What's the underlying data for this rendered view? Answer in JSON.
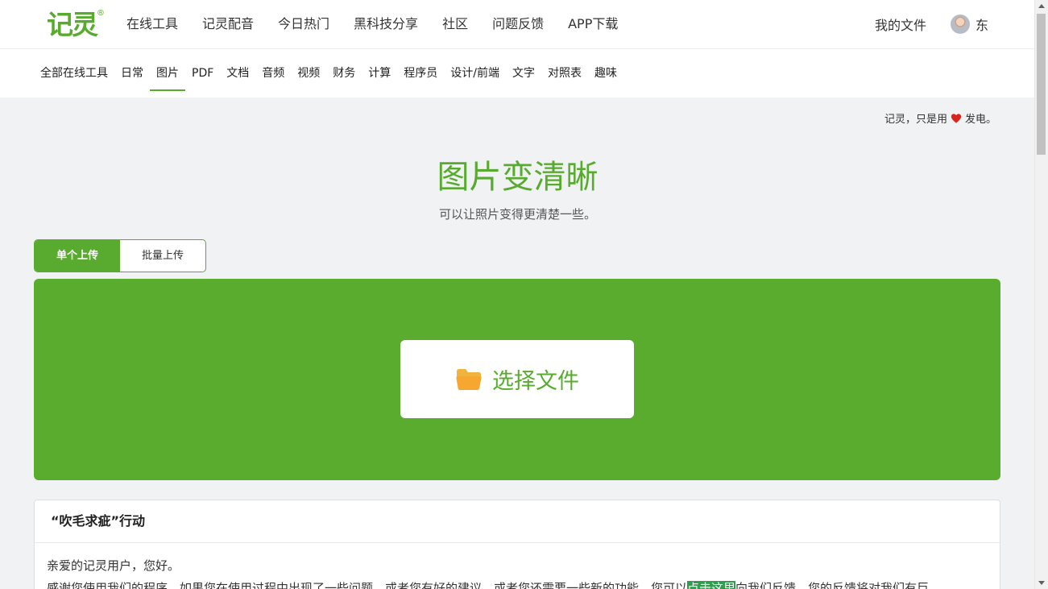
{
  "header": {
    "logo_text": "记灵",
    "logo_mark": "®",
    "nav": [
      "在线工具",
      "记灵配音",
      "今日热门",
      "黑科技分享",
      "社区",
      "问题反馈",
      "APP下载"
    ],
    "my_files": "我的文件",
    "username": "东"
  },
  "categories": {
    "items": [
      "全部在线工具",
      "日常",
      "图片",
      "PDF",
      "文档",
      "音频",
      "视频",
      "财务",
      "计算",
      "程序员",
      "设计/前端",
      "文字",
      "对照表",
      "趣味"
    ],
    "active": "图片"
  },
  "slogan": {
    "before": "记灵，只是用",
    "after": "发电。",
    "icon": "heart-icon"
  },
  "tool": {
    "title": "图片变清晰",
    "description": "可以让照片变得更清楚一些。"
  },
  "upload": {
    "tab_single": "单个上传",
    "tab_batch": "批量上传",
    "select_file": "选择文件",
    "icon": "folder-icon"
  },
  "notice": {
    "title": "“吹毛求疵”行动",
    "greeting": "亲爱的记灵用户，您好。",
    "body_before": "感谢您使用我们的程序，如果您在使用过程中出现了一些问题，或者您有好的建议，或者您还需要一些新的功能，您可以",
    "link": "点击这里",
    "body_after": "向我们反馈，您的反馈将对我们有巨"
  },
  "colors": {
    "brand": "#58ab2e",
    "dropzone": "#5aac2e",
    "highlight": "#2e9e4d",
    "heart": "#d9251d",
    "folder": "#f5a623"
  }
}
